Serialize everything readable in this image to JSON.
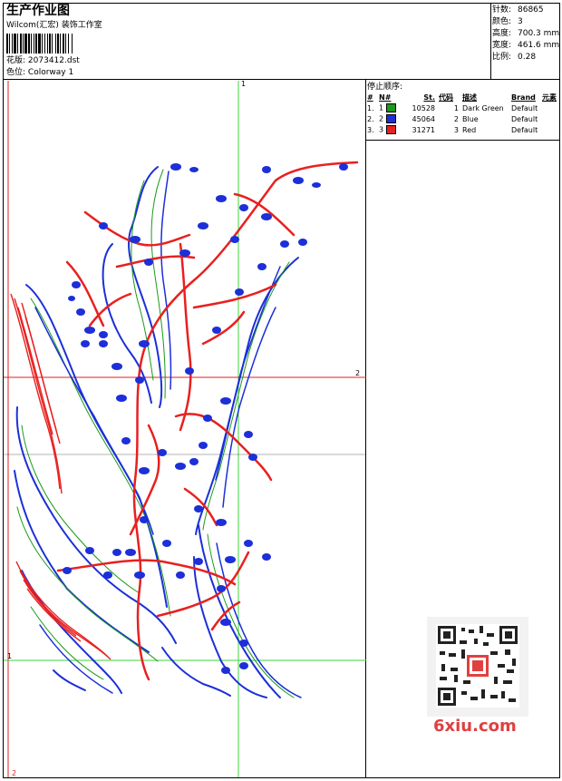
{
  "header": {
    "title": "生产作业图",
    "studio": "Wilcom(汇宏) 装饰工作室",
    "design_label": "花版:",
    "design_file": "2073412.dst",
    "colorway_label": "色位:",
    "colorway": "Colorway 1"
  },
  "stats": [
    {
      "label": "针数:",
      "value": "86865"
    },
    {
      "label": "颜色:",
      "value": "3"
    },
    {
      "label": "高度:",
      "value": "700.3 mm"
    },
    {
      "label": "宽度:",
      "value": "461.6 mm"
    },
    {
      "label": "比例:",
      "value": "0.28"
    }
  ],
  "stop_sequence": {
    "title": "停止顺序:",
    "headers": [
      "#",
      "N#",
      "St.",
      "代码",
      "描述",
      "Brand",
      "元素"
    ],
    "rows": [
      {
        "num": "1.",
        "n": "1",
        "color": "#1a9a1a",
        "stitches": "10528",
        "code": "1",
        "desc": "Dark Green",
        "brand": "Default"
      },
      {
        "num": "2.",
        "n": "2",
        "color": "#1c2fd8",
        "stitches": "45064",
        "code": "2",
        "desc": "Blue",
        "brand": "Default"
      },
      {
        "num": "3.",
        "n": "3",
        "color": "#e82020",
        "stitches": "31271",
        "code": "3",
        "desc": "Red",
        "brand": "Default"
      }
    ]
  },
  "canvas_markers": {
    "top": "1",
    "right": "2",
    "left": "1",
    "bottom": "2"
  },
  "watermark": "6xiu.com",
  "colors": {
    "green": "#1a9a1a",
    "blue": "#1c2fd8",
    "red": "#e82020",
    "guide_green": "#3cd63c",
    "guide_red": "#e02020"
  }
}
